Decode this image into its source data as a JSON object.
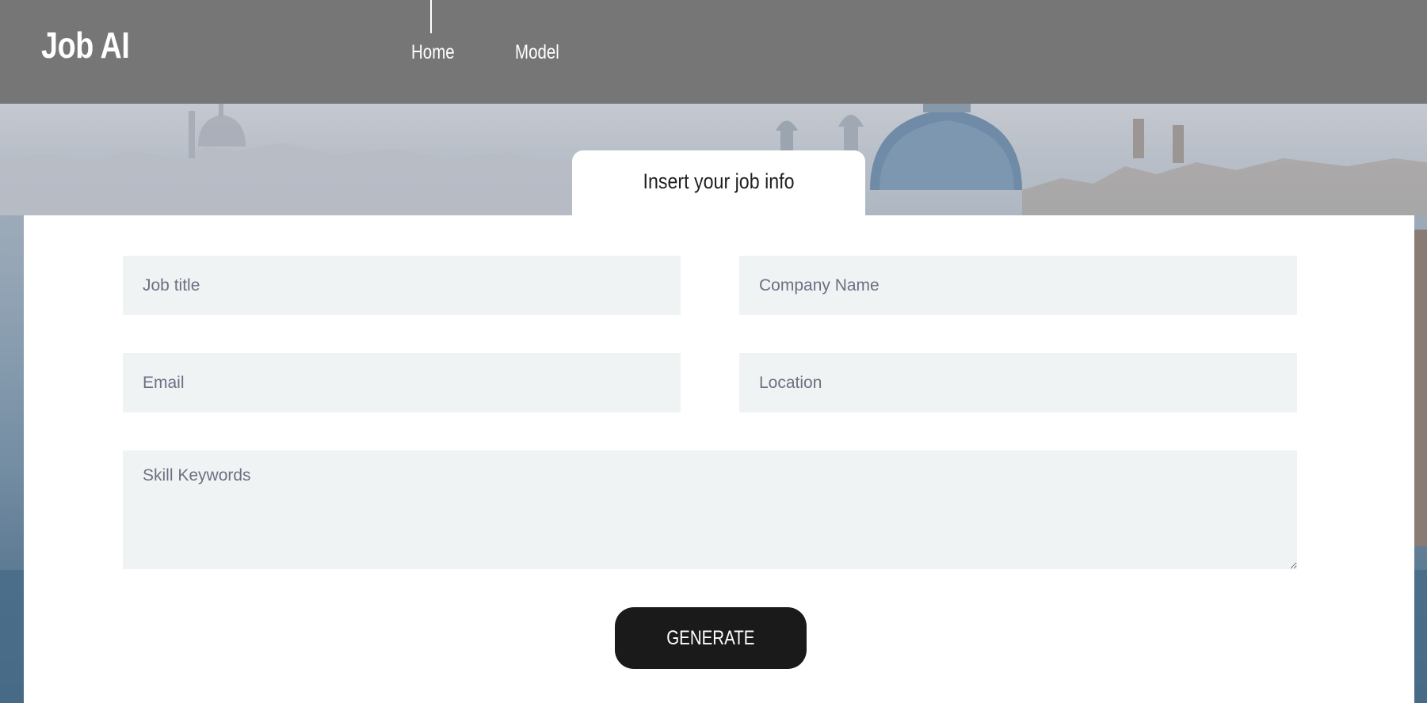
{
  "header": {
    "logo": "Job AI",
    "nav": [
      {
        "label": "Home",
        "active": true
      },
      {
        "label": "Model",
        "active": false
      }
    ]
  },
  "form": {
    "tab_label": "Insert your job info",
    "fields": {
      "job_title": {
        "placeholder": "Job title",
        "value": ""
      },
      "company_name": {
        "placeholder": "Company Name",
        "value": ""
      },
      "email": {
        "placeholder": "Email",
        "value": ""
      },
      "location": {
        "placeholder": "Location",
        "value": ""
      },
      "skill_keywords": {
        "placeholder": "Skill Keywords",
        "value": ""
      }
    },
    "submit_label": "GENERATE"
  },
  "colors": {
    "header_bg": "#767676",
    "field_bg": "#f0f3f4",
    "button_bg": "#1a1a1a",
    "placeholder_text": "#6f6f84"
  }
}
